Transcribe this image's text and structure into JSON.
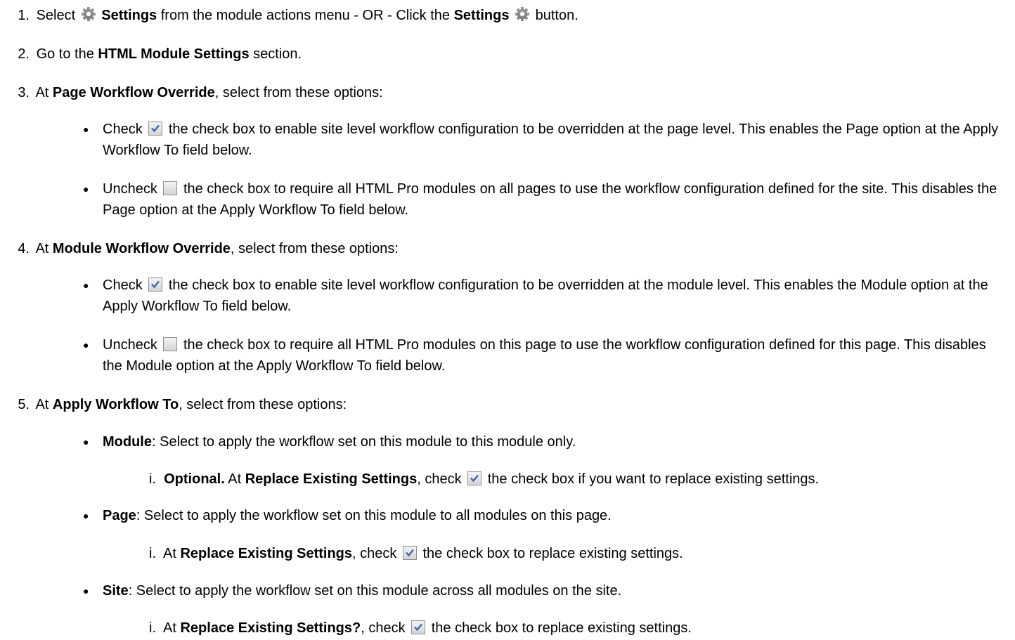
{
  "steps": [
    {
      "num": "1.",
      "pre": "Select",
      "bold1": "Settings",
      "mid": "from the module actions menu - OR - Click the",
      "bold2": "Settings",
      "post": "button.",
      "icon": "gear-icon"
    },
    {
      "num": "2.",
      "pre": "Go to the",
      "bold": "HTML Module Settings",
      "post": "section."
    },
    {
      "num": "3.",
      "pre": "At",
      "bold": "Page Workflow Override",
      "post": ", select from these options:",
      "bullets": [
        {
          "pre": "Check",
          "icon": "checked-checkbox-icon",
          "text": "the check box to enable site level workflow configuration to be overridden at the page level. This enables the Page option at the Apply Workflow To field below."
        },
        {
          "pre": "Uncheck",
          "icon": "unchecked-checkbox-icon",
          "text": "the check box to require all HTML Pro modules on all pages to use the workflow configuration defined for the site. This disables the Page option at the Apply Workflow To field below."
        }
      ]
    },
    {
      "num": "4.",
      "pre": "At",
      "bold": "Module Workflow Override",
      "post": ", select from these options:",
      "bullets": [
        {
          "pre": "Check",
          "icon": "checked-checkbox-icon",
          "text": "the check box to enable site level workflow configuration to be overridden at the module level. This enables the Module option at the Apply Workflow To field below."
        },
        {
          "pre": "Uncheck",
          "icon": "unchecked-checkbox-icon",
          "text": "the check box to require all HTML Pro modules on this page to use the workflow configuration defined for this page. This disables the Module option at the Apply Workflow To field below."
        }
      ]
    },
    {
      "num": "5.",
      "pre": "At",
      "bold": "Apply Workflow To",
      "post": ", select from these options:",
      "options": [
        {
          "bold": "Module",
          "text": ": Select to apply the workflow set on this module to this module only.",
          "sub": {
            "num": "i.",
            "bold_optional": "Optional.",
            "pre": "At",
            "bold": "Replace Existing Settings",
            "mid": ", check",
            "icon": "checked-checkbox-icon",
            "post": "the check box if you want to replace existing settings."
          }
        },
        {
          "bold": "Page",
          "text": ": Select to apply the workflow set on this module to all modules on this page.",
          "sub": {
            "num": "i.",
            "pre": "At",
            "bold": "Replace Existing Settings",
            "mid": ", check",
            "icon": "checked-checkbox-icon",
            "post": "the check box to replace existing settings."
          }
        },
        {
          "bold": "Site",
          "text": ": Select to apply the workflow set on this module across all modules on the site.",
          "sub": {
            "num": "i.",
            "pre": "At",
            "bold": "Replace Existing Settings?",
            "mid": ", check",
            "icon": "checked-checkbox-icon",
            "post": "the check box to replace existing settings."
          }
        }
      ]
    }
  ]
}
